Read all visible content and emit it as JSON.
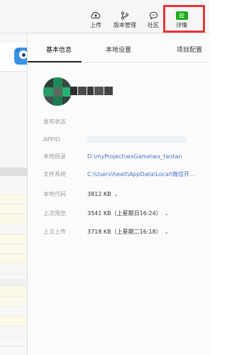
{
  "toolbar": {
    "upload_label": "上传",
    "version_label": "版本管理",
    "community_label": "社区",
    "detail_label": "详情"
  },
  "detail_panel": {
    "tabs": [
      {
        "label": "基本信息",
        "active": true
      },
      {
        "label": "本地设置",
        "active": false
      },
      {
        "label": "项目配置",
        "active": false
      }
    ],
    "info": {
      "publish_status_label": "发布状态",
      "appid_label": "APPID",
      "local_dir_label": "本地目录",
      "local_dir_value": "D:\\myProject\\wxGame\\wx_tantan",
      "file_system_label": "文件系统",
      "file_system_value": "C:\\Users\\healt\\AppData\\Local\\微信开...",
      "local_code_label": "本地代码",
      "local_code_value": "3812 KB",
      "last_preview_label": "上次预览",
      "last_preview_value": "3541 KB（上星期日16:24）",
      "last_upload_label": "上次上传",
      "last_upload_value": "3718 KB（上星期二16:18）"
    }
  },
  "colors": {
    "accent_green": "#1aad19",
    "highlight_red": "#e5343c",
    "link_blue": "#4674c2"
  },
  "icons": [
    "upload-cloud-icon",
    "version-branch-icon",
    "community-chat-icon",
    "detail-menu-icon",
    "mascot-logo",
    "chevron-down-icon"
  ]
}
